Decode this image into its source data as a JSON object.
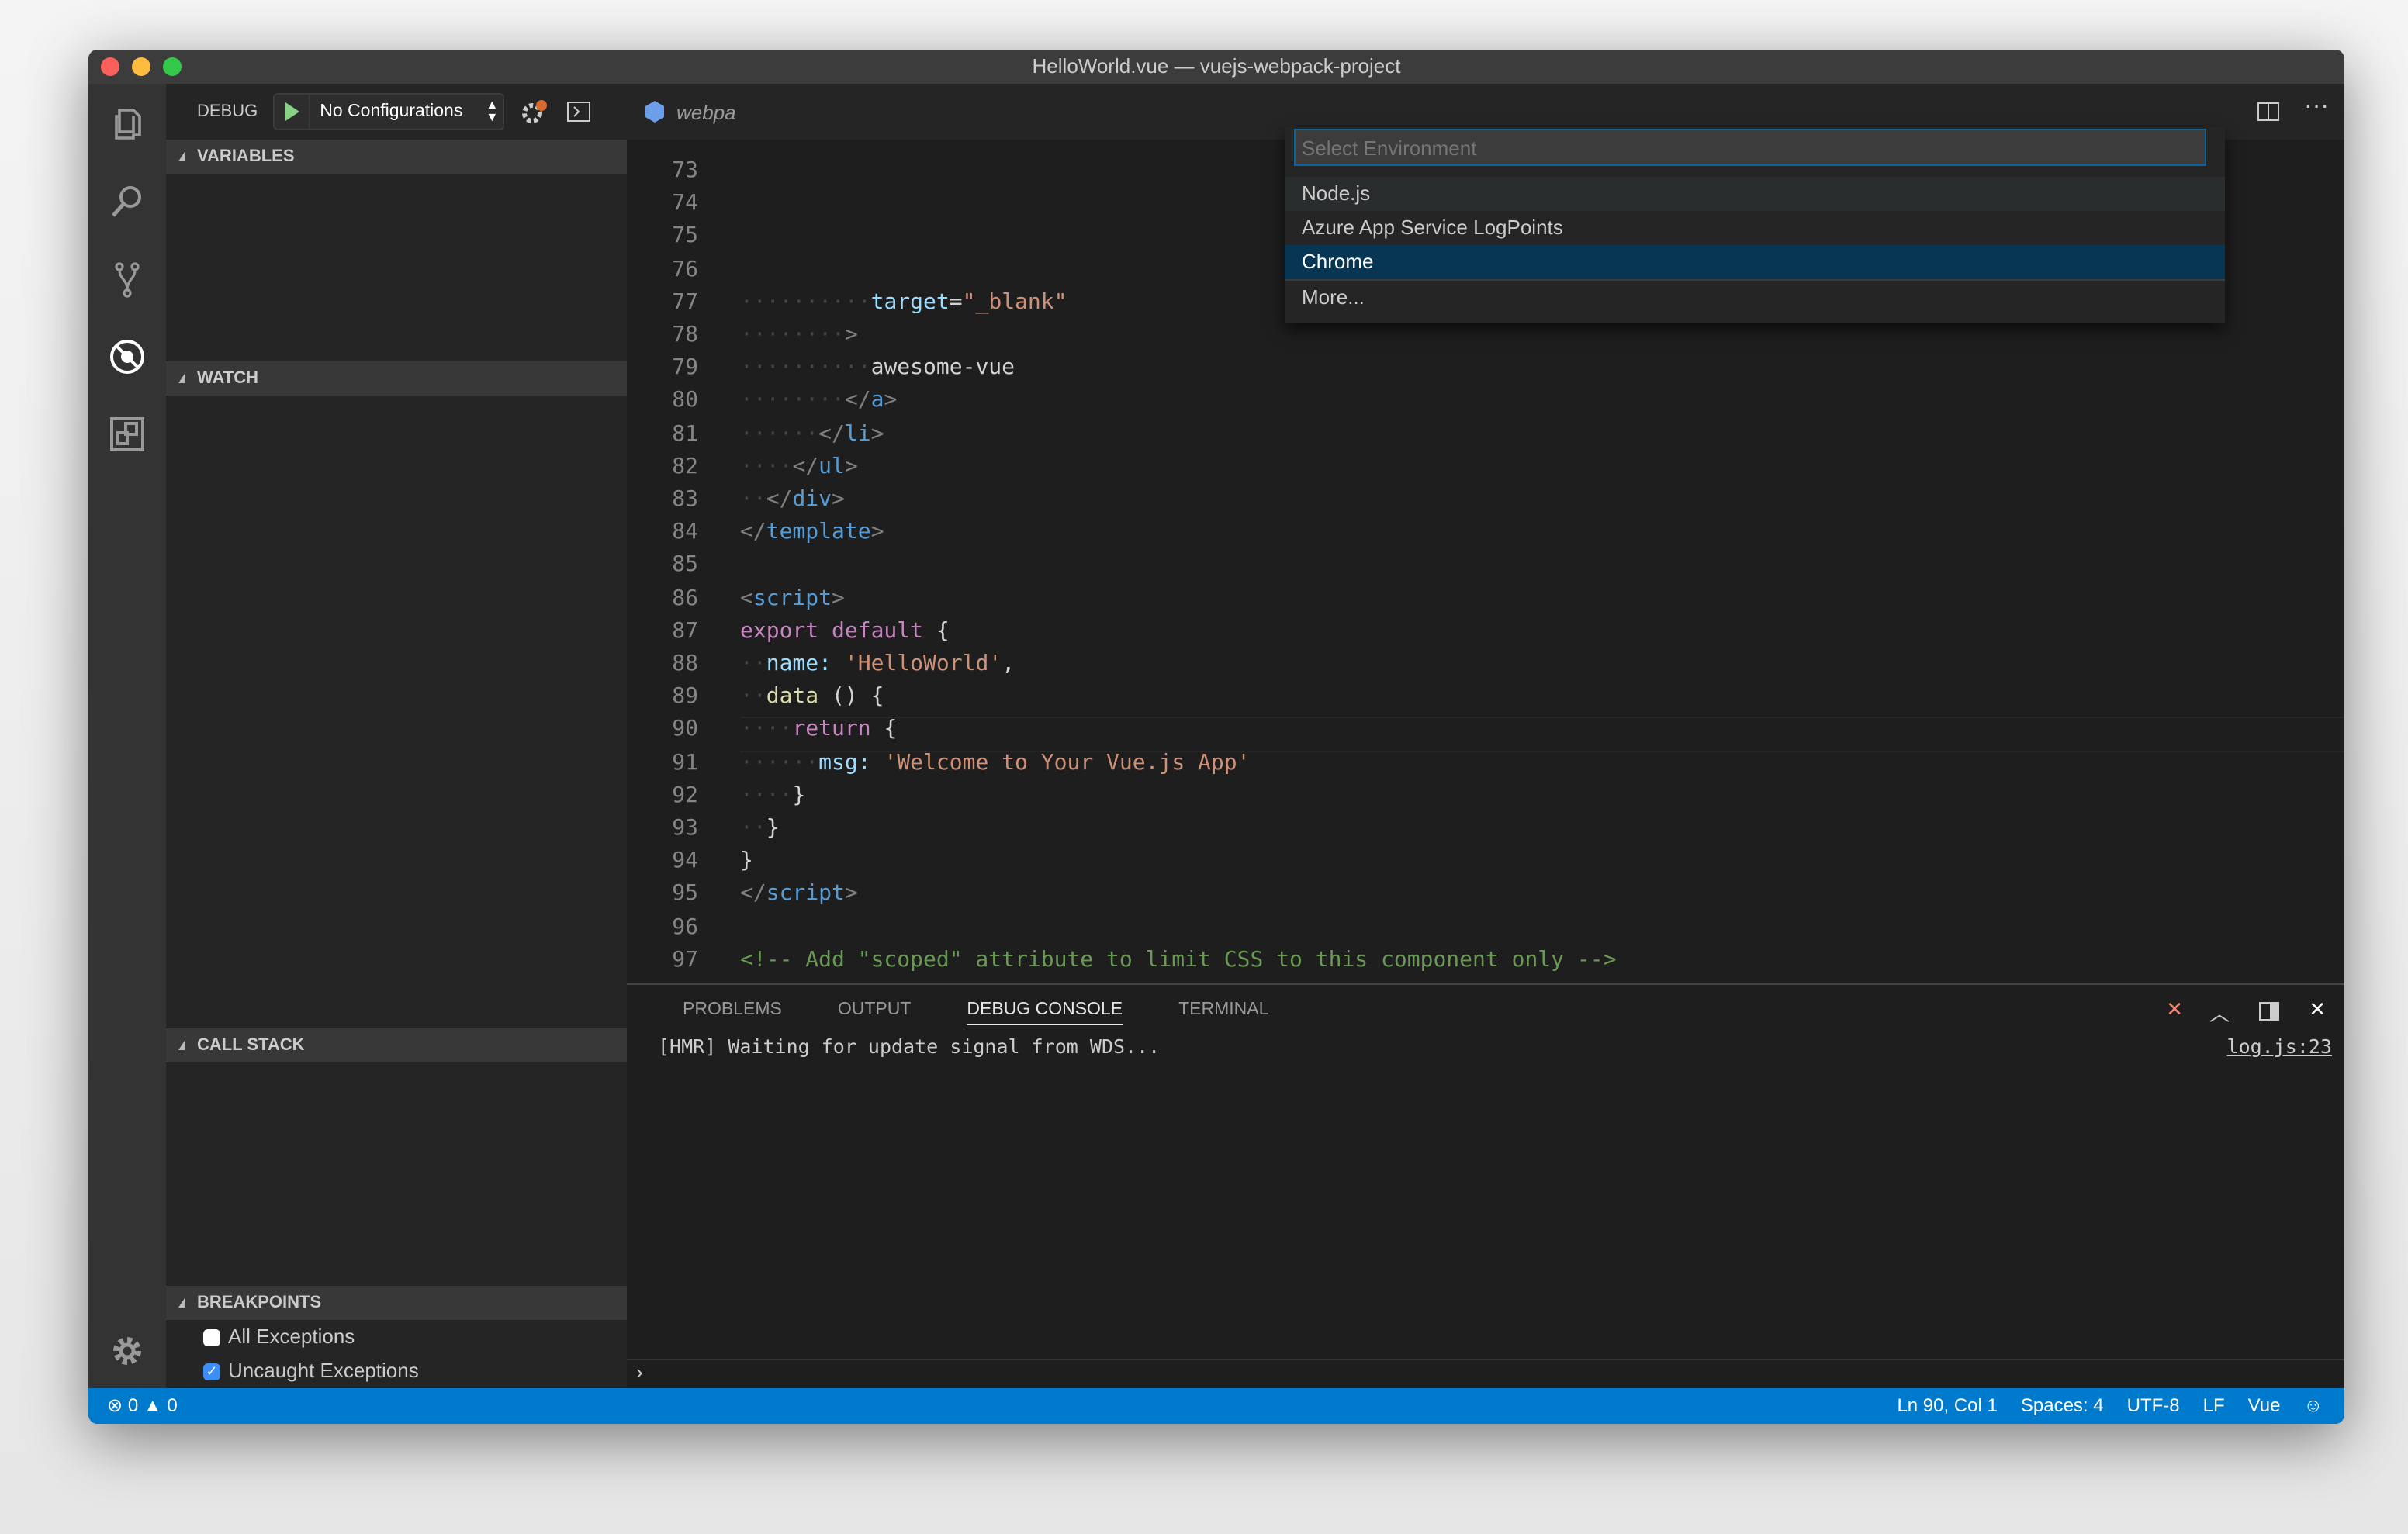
{
  "window": {
    "title": "HelloWorld.vue — vuejs-webpack-project"
  },
  "activity_bar": {
    "items": [
      "explorer",
      "search",
      "source-control",
      "debug",
      "extensions"
    ],
    "settings": "gear"
  },
  "debug_toolbar": {
    "label": "DEBUG",
    "configuration": "No Configurations"
  },
  "sidebar": {
    "variables": "VARIABLES",
    "watch": "WATCH",
    "call_stack": "CALL STACK",
    "breakpoints": "BREAKPOINTS",
    "breakpoint_items": [
      {
        "label": "All Exceptions",
        "checked": false
      },
      {
        "label": "Uncaught Exceptions",
        "checked": true
      }
    ]
  },
  "editor": {
    "tab_label": "webpa",
    "quick_pick": {
      "placeholder": "Select Environment",
      "items": [
        "Node.js",
        "Azure App Service LogPoints",
        "Chrome",
        "More..."
      ],
      "selected": "Chrome"
    },
    "lines": [
      {
        "n": "73",
        "indent": 0,
        "tokens": []
      },
      {
        "n": "74",
        "indent": 0,
        "tokens": []
      },
      {
        "n": "75",
        "indent": 0,
        "tokens": []
      },
      {
        "n": "76",
        "indent": 0,
        "tokens": []
      },
      {
        "n": "77",
        "indent": 10,
        "tokens": [
          [
            "target",
            "attr"
          ],
          [
            "=",
            "tx"
          ],
          [
            "\"_blank\"",
            "str"
          ]
        ]
      },
      {
        "n": "78",
        "indent": 8,
        "tokens": [
          [
            ">",
            "br"
          ]
        ]
      },
      {
        "n": "79",
        "indent": 10,
        "tokens": [
          [
            "awesome-vue",
            "tx"
          ]
        ]
      },
      {
        "n": "80",
        "indent": 8,
        "tokens": [
          [
            "</",
            "br"
          ],
          [
            "a",
            "tag"
          ],
          [
            ">",
            "br"
          ]
        ]
      },
      {
        "n": "81",
        "indent": 6,
        "tokens": [
          [
            "</",
            "br"
          ],
          [
            "li",
            "tag"
          ],
          [
            ">",
            "br"
          ]
        ]
      },
      {
        "n": "82",
        "indent": 4,
        "tokens": [
          [
            "</",
            "br"
          ],
          [
            "ul",
            "tag"
          ],
          [
            ">",
            "br"
          ]
        ]
      },
      {
        "n": "83",
        "indent": 2,
        "tokens": [
          [
            "</",
            "br"
          ],
          [
            "div",
            "tag"
          ],
          [
            ">",
            "br"
          ]
        ]
      },
      {
        "n": "84",
        "indent": 0,
        "tokens": [
          [
            "</",
            "br"
          ],
          [
            "template",
            "tag"
          ],
          [
            ">",
            "br"
          ]
        ]
      },
      {
        "n": "85",
        "indent": 0,
        "tokens": []
      },
      {
        "n": "86",
        "indent": 0,
        "tokens": [
          [
            "<",
            "br"
          ],
          [
            "script",
            "tag"
          ],
          [
            ">",
            "br"
          ]
        ]
      },
      {
        "n": "87",
        "indent": 0,
        "tokens": [
          [
            "export default",
            "kw"
          ],
          [
            " {",
            "tx"
          ]
        ]
      },
      {
        "n": "88",
        "indent": 2,
        "tokens": [
          [
            "name:",
            "attr"
          ],
          [
            " ",
            "tx"
          ],
          [
            "'HelloWorld'",
            "str"
          ],
          [
            ",",
            "tx"
          ]
        ]
      },
      {
        "n": "89",
        "indent": 2,
        "tokens": [
          [
            "data",
            "fn"
          ],
          [
            " () {",
            "tx"
          ]
        ]
      },
      {
        "n": "90",
        "indent": 4,
        "tokens": [
          [
            "return",
            "kw"
          ],
          [
            " {",
            "tx"
          ]
        ]
      },
      {
        "n": "91",
        "indent": 6,
        "tokens": [
          [
            "msg:",
            "attr"
          ],
          [
            " ",
            "tx"
          ],
          [
            "'Welcome to Your Vue.js App'",
            "str"
          ]
        ]
      },
      {
        "n": "92",
        "indent": 4,
        "tokens": [
          [
            "}",
            "tx"
          ]
        ]
      },
      {
        "n": "93",
        "indent": 2,
        "tokens": [
          [
            "}",
            "tx"
          ]
        ]
      },
      {
        "n": "94",
        "indent": 0,
        "tokens": [
          [
            "}",
            "tx"
          ]
        ]
      },
      {
        "n": "95",
        "indent": 0,
        "tokens": [
          [
            "</",
            "br"
          ],
          [
            "script",
            "tag"
          ],
          [
            ">",
            "br"
          ]
        ]
      },
      {
        "n": "96",
        "indent": 0,
        "tokens": []
      },
      {
        "n": "97",
        "indent": 0,
        "tokens": [
          [
            "<!-- Add \"scoped\" attribute to limit CSS to this component only -->",
            "cm"
          ]
        ]
      }
    ]
  },
  "panel": {
    "tabs": [
      "PROBLEMS",
      "OUTPUT",
      "DEBUG CONSOLE",
      "TERMINAL"
    ],
    "active_tab": "DEBUG CONSOLE",
    "message": "[HMR] Waiting for update signal from WDS...",
    "source_link": "log.js:23"
  },
  "status_bar": {
    "errors": "0",
    "warnings": "0",
    "position": "Ln 90, Col 1",
    "spaces": "Spaces: 4",
    "encoding": "UTF-8",
    "eol": "LF",
    "language": "Vue",
    "color": "#007acc"
  }
}
